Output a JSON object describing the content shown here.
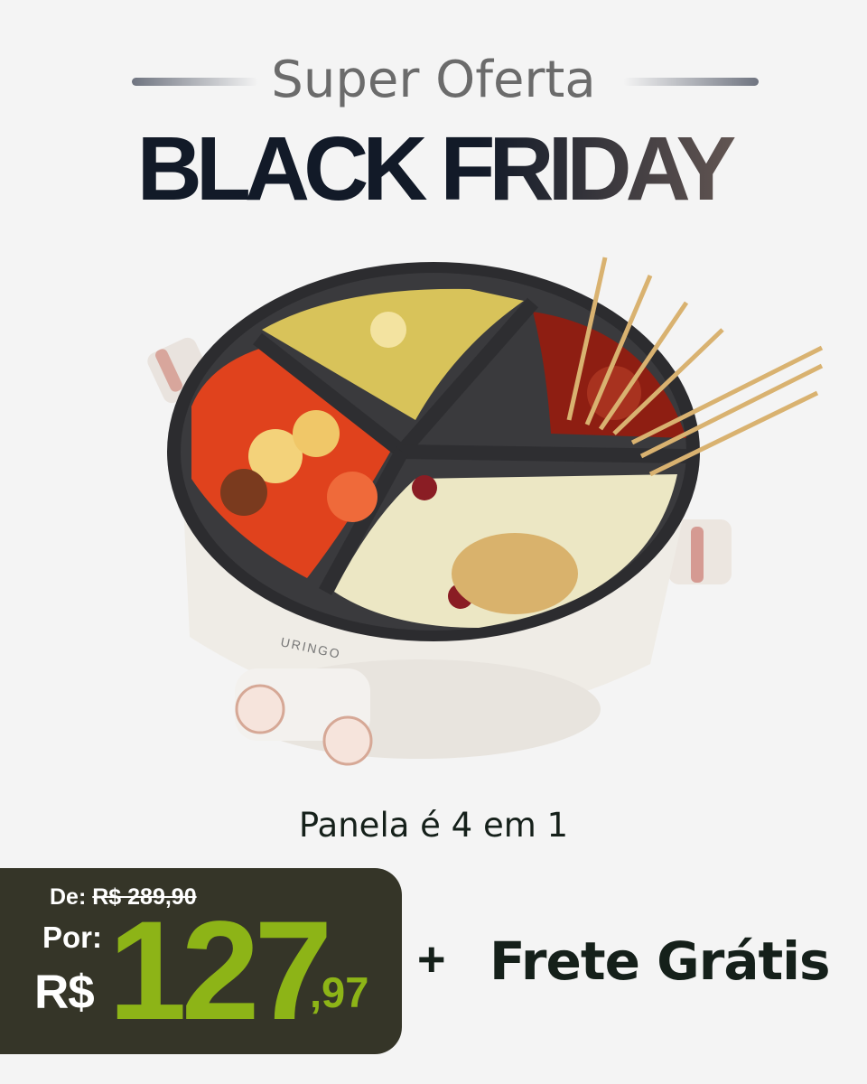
{
  "header": {
    "kicker": "Super Oferta",
    "title": "BLACK FRIDAY"
  },
  "product": {
    "brand": "URINGO",
    "caption": "Panela é 4 em 1"
  },
  "price": {
    "from_label": "De:",
    "old_price": "R$ 289,90",
    "for_label": "Por:",
    "currency": "R$",
    "integer": "127",
    "cents": ",97"
  },
  "shipping": {
    "plus": "+",
    "label": "Frete Grátis"
  },
  "colors": {
    "background": "#f4f4f4",
    "title_dark": "#121a28",
    "price_box": "#353528",
    "price_green": "#8db417"
  }
}
